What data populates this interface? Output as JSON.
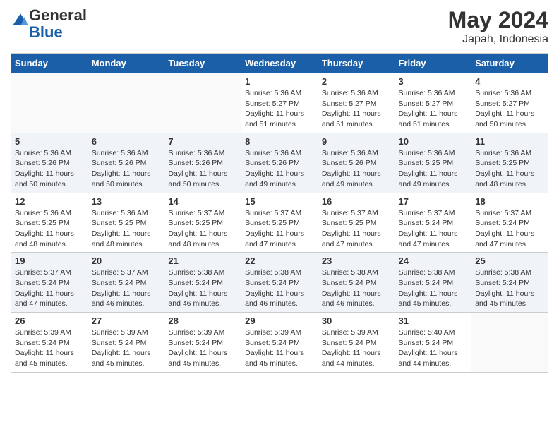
{
  "header": {
    "logo_general": "General",
    "logo_blue": "Blue",
    "month": "May 2024",
    "location": "Japah, Indonesia"
  },
  "weekdays": [
    "Sunday",
    "Monday",
    "Tuesday",
    "Wednesday",
    "Thursday",
    "Friday",
    "Saturday"
  ],
  "weeks": [
    [
      {
        "day": "",
        "info": ""
      },
      {
        "day": "",
        "info": ""
      },
      {
        "day": "",
        "info": ""
      },
      {
        "day": "1",
        "info": "Sunrise: 5:36 AM\nSunset: 5:27 PM\nDaylight: 11 hours\nand 51 minutes."
      },
      {
        "day": "2",
        "info": "Sunrise: 5:36 AM\nSunset: 5:27 PM\nDaylight: 11 hours\nand 51 minutes."
      },
      {
        "day": "3",
        "info": "Sunrise: 5:36 AM\nSunset: 5:27 PM\nDaylight: 11 hours\nand 51 minutes."
      },
      {
        "day": "4",
        "info": "Sunrise: 5:36 AM\nSunset: 5:27 PM\nDaylight: 11 hours\nand 50 minutes."
      }
    ],
    [
      {
        "day": "5",
        "info": "Sunrise: 5:36 AM\nSunset: 5:26 PM\nDaylight: 11 hours\nand 50 minutes."
      },
      {
        "day": "6",
        "info": "Sunrise: 5:36 AM\nSunset: 5:26 PM\nDaylight: 11 hours\nand 50 minutes."
      },
      {
        "day": "7",
        "info": "Sunrise: 5:36 AM\nSunset: 5:26 PM\nDaylight: 11 hours\nand 50 minutes."
      },
      {
        "day": "8",
        "info": "Sunrise: 5:36 AM\nSunset: 5:26 PM\nDaylight: 11 hours\nand 49 minutes."
      },
      {
        "day": "9",
        "info": "Sunrise: 5:36 AM\nSunset: 5:26 PM\nDaylight: 11 hours\nand 49 minutes."
      },
      {
        "day": "10",
        "info": "Sunrise: 5:36 AM\nSunset: 5:25 PM\nDaylight: 11 hours\nand 49 minutes."
      },
      {
        "day": "11",
        "info": "Sunrise: 5:36 AM\nSunset: 5:25 PM\nDaylight: 11 hours\nand 48 minutes."
      }
    ],
    [
      {
        "day": "12",
        "info": "Sunrise: 5:36 AM\nSunset: 5:25 PM\nDaylight: 11 hours\nand 48 minutes."
      },
      {
        "day": "13",
        "info": "Sunrise: 5:36 AM\nSunset: 5:25 PM\nDaylight: 11 hours\nand 48 minutes."
      },
      {
        "day": "14",
        "info": "Sunrise: 5:37 AM\nSunset: 5:25 PM\nDaylight: 11 hours\nand 48 minutes."
      },
      {
        "day": "15",
        "info": "Sunrise: 5:37 AM\nSunset: 5:25 PM\nDaylight: 11 hours\nand 47 minutes."
      },
      {
        "day": "16",
        "info": "Sunrise: 5:37 AM\nSunset: 5:25 PM\nDaylight: 11 hours\nand 47 minutes."
      },
      {
        "day": "17",
        "info": "Sunrise: 5:37 AM\nSunset: 5:24 PM\nDaylight: 11 hours\nand 47 minutes."
      },
      {
        "day": "18",
        "info": "Sunrise: 5:37 AM\nSunset: 5:24 PM\nDaylight: 11 hours\nand 47 minutes."
      }
    ],
    [
      {
        "day": "19",
        "info": "Sunrise: 5:37 AM\nSunset: 5:24 PM\nDaylight: 11 hours\nand 47 minutes."
      },
      {
        "day": "20",
        "info": "Sunrise: 5:37 AM\nSunset: 5:24 PM\nDaylight: 11 hours\nand 46 minutes."
      },
      {
        "day": "21",
        "info": "Sunrise: 5:38 AM\nSunset: 5:24 PM\nDaylight: 11 hours\nand 46 minutes."
      },
      {
        "day": "22",
        "info": "Sunrise: 5:38 AM\nSunset: 5:24 PM\nDaylight: 11 hours\nand 46 minutes."
      },
      {
        "day": "23",
        "info": "Sunrise: 5:38 AM\nSunset: 5:24 PM\nDaylight: 11 hours\nand 46 minutes."
      },
      {
        "day": "24",
        "info": "Sunrise: 5:38 AM\nSunset: 5:24 PM\nDaylight: 11 hours\nand 45 minutes."
      },
      {
        "day": "25",
        "info": "Sunrise: 5:38 AM\nSunset: 5:24 PM\nDaylight: 11 hours\nand 45 minutes."
      }
    ],
    [
      {
        "day": "26",
        "info": "Sunrise: 5:39 AM\nSunset: 5:24 PM\nDaylight: 11 hours\nand 45 minutes."
      },
      {
        "day": "27",
        "info": "Sunrise: 5:39 AM\nSunset: 5:24 PM\nDaylight: 11 hours\nand 45 minutes."
      },
      {
        "day": "28",
        "info": "Sunrise: 5:39 AM\nSunset: 5:24 PM\nDaylight: 11 hours\nand 45 minutes."
      },
      {
        "day": "29",
        "info": "Sunrise: 5:39 AM\nSunset: 5:24 PM\nDaylight: 11 hours\nand 45 minutes."
      },
      {
        "day": "30",
        "info": "Sunrise: 5:39 AM\nSunset: 5:24 PM\nDaylight: 11 hours\nand 44 minutes."
      },
      {
        "day": "31",
        "info": "Sunrise: 5:40 AM\nSunset: 5:24 PM\nDaylight: 11 hours\nand 44 minutes."
      },
      {
        "day": "",
        "info": ""
      }
    ]
  ]
}
